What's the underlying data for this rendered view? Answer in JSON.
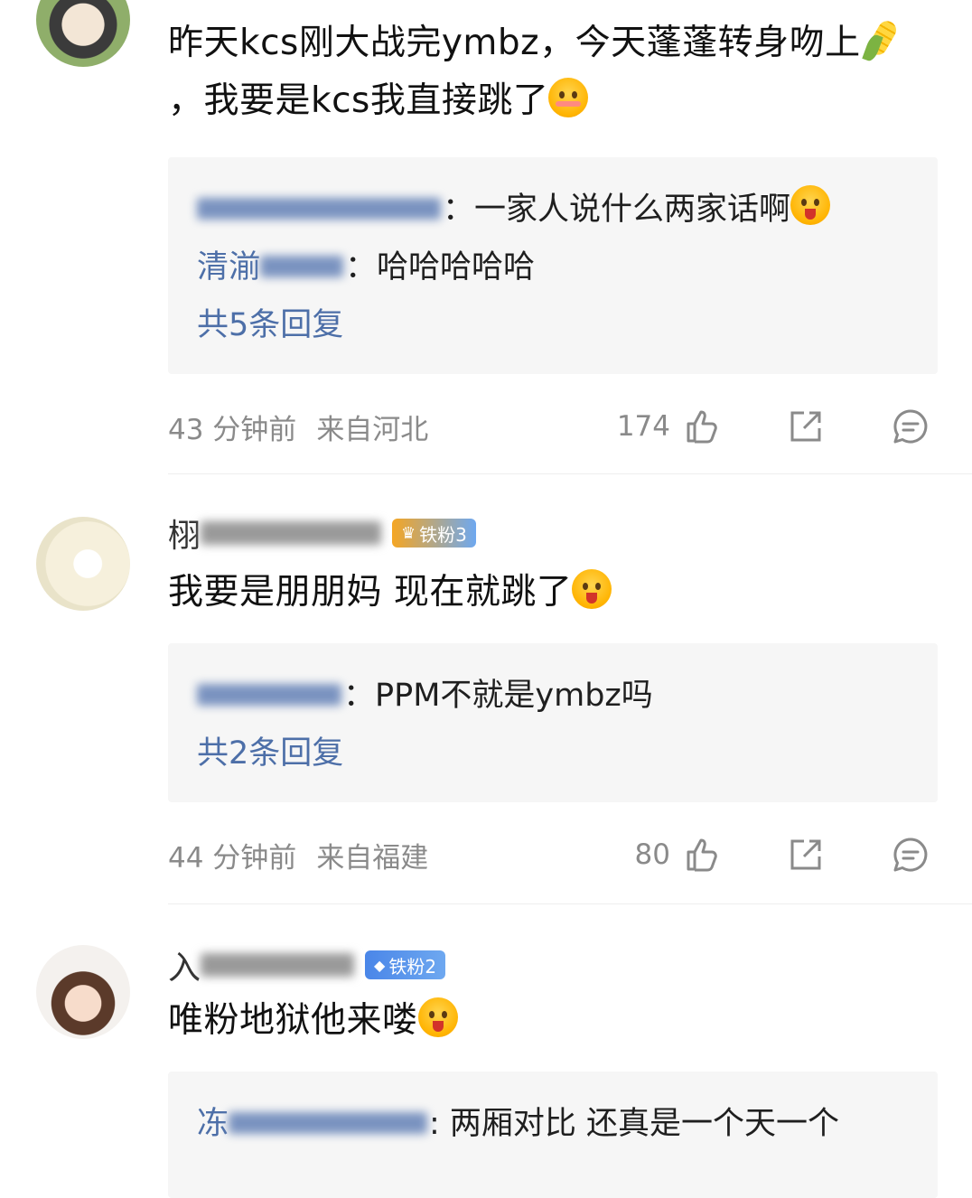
{
  "comments": [
    {
      "text_parts": [
        "昨天kcs刚大战完ymbz，今天蓬蓬转身吻上",
        "，我要是kcs我直接跳了"
      ],
      "replies": [
        {
          "name_visible": "",
          "text": "：一家人说什么两家话啊"
        },
        {
          "name_visible": "清湔",
          "text": "：哈哈哈哈哈"
        }
      ],
      "more_replies": "共5条回复",
      "time": "43 分钟前",
      "location": "来自河北",
      "likes": "174"
    },
    {
      "name_visible": "栩",
      "badge": "铁粉3",
      "text": "我要是朋朋妈 现在就跳了",
      "replies": [
        {
          "name_visible": "",
          "text": "：PPM不就是ymbz吗"
        }
      ],
      "more_replies": "共2条回复",
      "time": "44 分钟前",
      "location": "来自福建",
      "likes": "80"
    },
    {
      "name_visible": "入",
      "badge": "铁粉2",
      "text": "唯粉地狱他来喽",
      "replies": [
        {
          "name_visible": "冻",
          "text": ": 两厢对比 还真是一个天一个"
        }
      ]
    }
  ],
  "icons": {
    "like": "thumbs-up-icon",
    "share": "share-icon",
    "comment": "comment-icon",
    "emoji_tongue": "tongue-emoji-icon",
    "emoji_blush": "blush-emoji-icon",
    "corn": "corn-emoji-icon",
    "badge": "crown-badge-icon"
  },
  "colors": {
    "link_blue": "#4d6fa8",
    "meta_gray": "#8a8a8a",
    "reply_bg": "#f6f6f6",
    "badge_blue": "#4a86e8"
  }
}
